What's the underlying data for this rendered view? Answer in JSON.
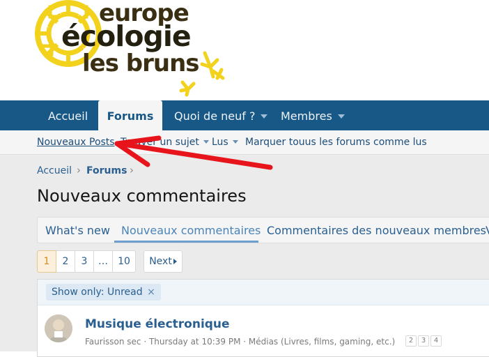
{
  "logo": {
    "line1": "europe",
    "line2": "écologie",
    "line3": "les bruns"
  },
  "nav": {
    "tabs": [
      {
        "label": "Accueil"
      },
      {
        "label": "Forums"
      },
      {
        "label": "Quoi de neuf ?"
      },
      {
        "label": "Membres"
      }
    ]
  },
  "subnav": {
    "new_posts": "Nouveaux Posts",
    "find_thread": "Trouver un sujet",
    "read": "Lus",
    "mark_read": "Marquer touus les forums comme lus"
  },
  "breadcrumb": {
    "home": "Accueil",
    "forums": "Forums"
  },
  "page_title": "Nouveaux commentaires",
  "tabs": [
    {
      "label": "What's new"
    },
    {
      "label": "Nouveaux commentaires"
    },
    {
      "label": "Commentaires des nouveaux membres"
    }
  ],
  "pagination": {
    "pages": [
      "1",
      "2",
      "3",
      "…",
      "10"
    ],
    "next": "Next"
  },
  "filter": {
    "label": "Show only: Unread",
    "remove": "×"
  },
  "thread": {
    "title": "Musique électronique",
    "meta": "Faurisson sec · Thursday at 10:39 PM · Médias (Livres, films, gaming, etc.)",
    "mini_pages": [
      "2",
      "3",
      "4"
    ]
  },
  "colors": {
    "nav_bg": "#185886",
    "logo_yellow": "#f2d21c",
    "annotation_arrow": "#e8141c"
  }
}
